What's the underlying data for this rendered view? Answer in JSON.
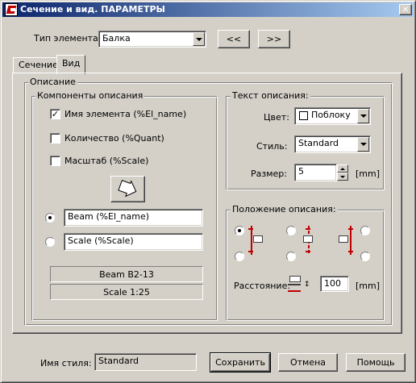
{
  "window": {
    "title": "Сечение и вид. ПАРАМЕТРЫ"
  },
  "element_type": {
    "label": "Тип элемента:",
    "value": "Балка"
  },
  "nav": {
    "prev": "<<",
    "next": ">>"
  },
  "tabs": [
    {
      "label": "Сечение"
    },
    {
      "label": "Вид"
    }
  ],
  "description": {
    "group_label": "Описание",
    "components": {
      "label": "Компоненты описания",
      "items": [
        {
          "label": "Имя элемента (%El_name)",
          "checked": true
        },
        {
          "label": "Количество (%Quant)",
          "checked": false
        },
        {
          "label": "Масштаб (%Scale)",
          "checked": false
        }
      ],
      "line1": "Beam (%El_name)",
      "line2": "Scale (%Scale)",
      "preview1": "Beam B2-13",
      "preview2": "Scale 1:25"
    },
    "text": {
      "label": "Текст описания:",
      "color_label": "Цвет:",
      "color_value": "Поблоку",
      "style_label": "Стиль:",
      "style_value": "Standard",
      "size_label": "Размер:",
      "size_value": "5",
      "size_unit": "[mm]"
    },
    "position": {
      "label": "Положение описания:",
      "distance_label": "Расстояние:",
      "distance_value": "100",
      "distance_unit": "[mm]"
    }
  },
  "footer": {
    "style_label": "Имя стиля:",
    "style_value": "Standard",
    "save": "Сохранить",
    "cancel": "Отмена",
    "help": "Помощь"
  },
  "colors": {
    "accent": "#c00000",
    "title_start": "#0a246a",
    "title_end": "#a6caf0"
  }
}
